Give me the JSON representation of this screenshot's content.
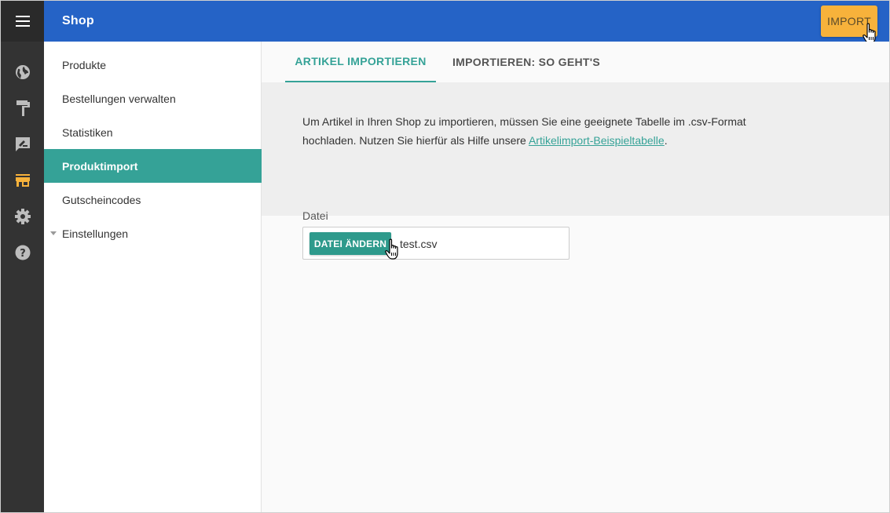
{
  "app": {
    "title": "Shop",
    "import_button": "IMPORT"
  },
  "rail": {
    "icons": [
      "menu-icon",
      "globe-icon",
      "paint-roller-icon",
      "signature-icon",
      "store-icon",
      "gear-icon",
      "help-icon"
    ],
    "active_icon": "store-icon",
    "colors": {
      "icon": "#bdbdbd",
      "active": "#f7b23b"
    }
  },
  "sidebar": {
    "items": [
      {
        "label": "Produkte"
      },
      {
        "label": "Bestellungen verwalten"
      },
      {
        "label": "Statistiken"
      },
      {
        "label": "Produktimport",
        "active": true
      },
      {
        "label": "Gutscheincodes"
      },
      {
        "label": "Einstellungen",
        "collapsible": true
      }
    ]
  },
  "tabs": [
    {
      "label": "ARTIKEL IMPORTIEREN",
      "active": true
    },
    {
      "label": "IMPORTIEREN: SO GEHT'S"
    }
  ],
  "info": {
    "text": "Um Artikel in Ihren Shop zu importieren, müssen Sie eine geeignete Tabelle im .csv-Format hochladen. Nutzen Sie hierfür als Hilfe unsere ",
    "link": "Artikelimport-Beispieltabelle",
    "suffix": "."
  },
  "file": {
    "label": "Datei",
    "button": "DATEI ÄNDERN",
    "filename": "test.csv"
  },
  "colors": {
    "topbar": "#2563c6",
    "accent": "#35a297",
    "import_button": "#f7b23b",
    "rail": "#333333"
  }
}
